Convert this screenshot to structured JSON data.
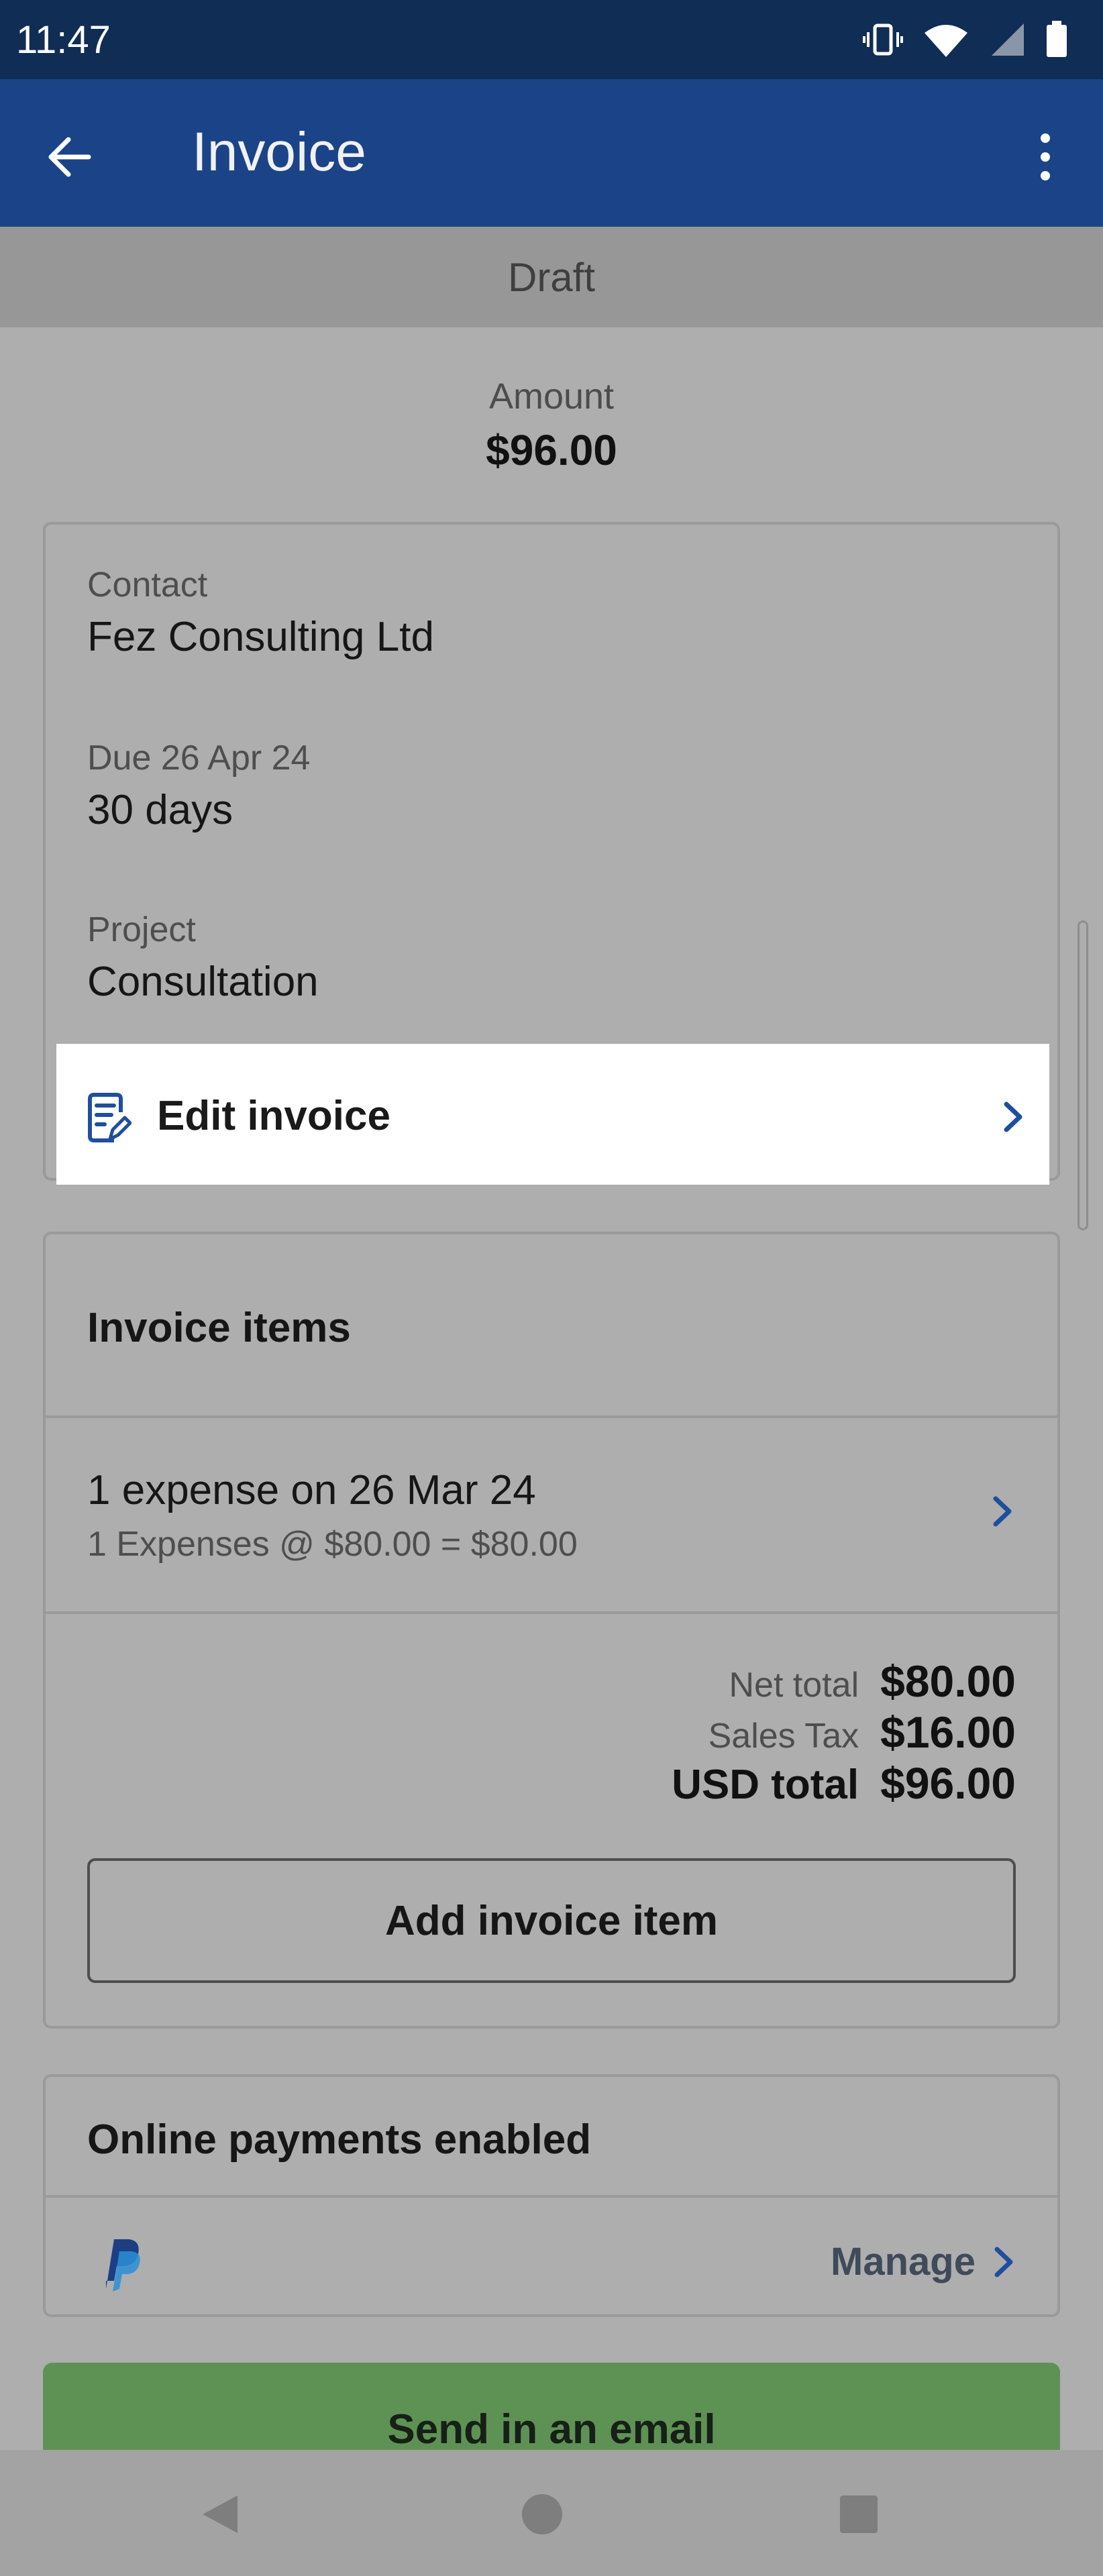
{
  "status_bar": {
    "time": "11:47"
  },
  "app_bar": {
    "title": "Invoice"
  },
  "status_band": {
    "label": "Draft"
  },
  "amount": {
    "label": "Amount",
    "value": "$96.00"
  },
  "details": {
    "contact_label": "Contact",
    "contact_value": "Fez Consulting Ltd",
    "due_label": "Due 26 Apr 24",
    "due_value": "30 days",
    "project_label": "Project",
    "project_value": "Consultation",
    "edit_label": "Edit invoice"
  },
  "invoice_items": {
    "title": "Invoice items",
    "items": [
      {
        "title": "1 expense on 26 Mar 24",
        "subtitle": "1 Expenses @ $80.00 = $80.00"
      }
    ],
    "totals": {
      "net_label": "Net total",
      "net_value": "$80.00",
      "tax_label": "Sales Tax",
      "tax_value": "$16.00",
      "total_label": "USD total",
      "total_value": "$96.00"
    },
    "add_button_label": "Add invoice item"
  },
  "online_payments": {
    "title": "Online payments enabled",
    "manage_label": "Manage"
  },
  "actions": {
    "send_email_label": "Send in an email"
  },
  "colors": {
    "status_bar": "#102d55",
    "app_bar": "#1b4488",
    "accent_blue": "#1f4f9c",
    "send_green": "#5e9255"
  }
}
